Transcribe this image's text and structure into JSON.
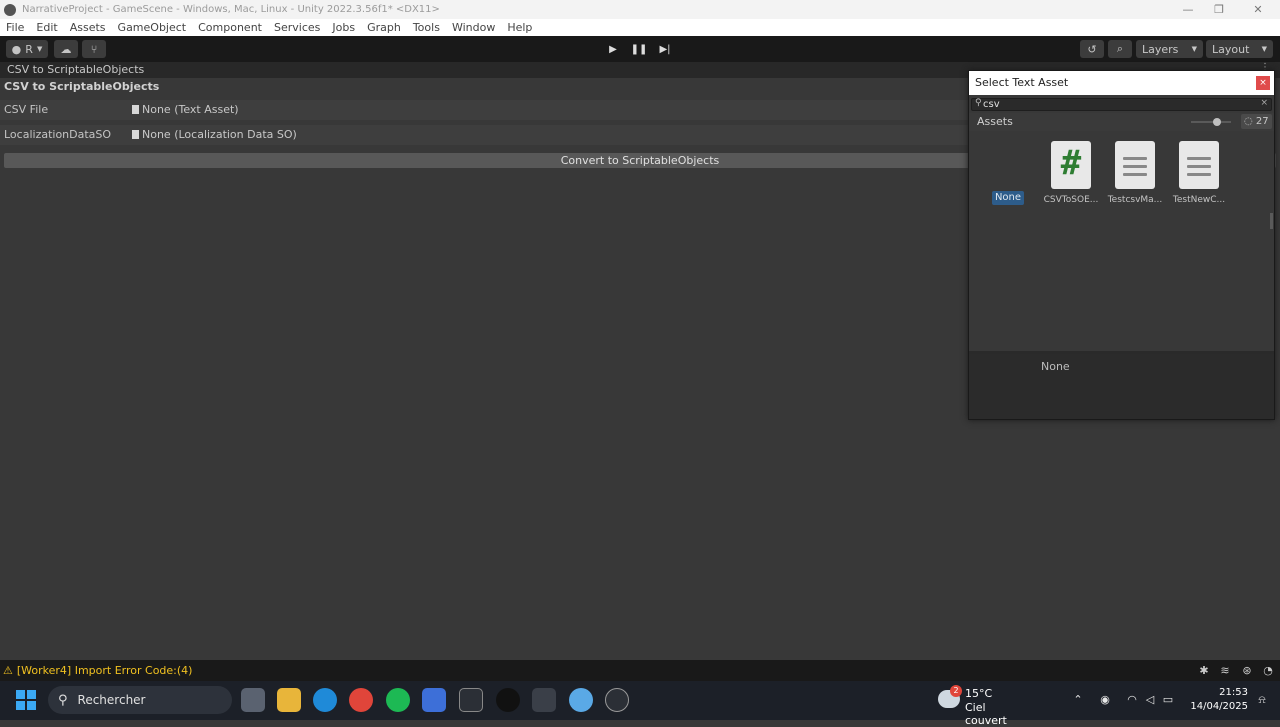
{
  "window": {
    "title": "NarrativeProject - GameScene - Windows, Mac, Linux - Unity 2022.3.56f1* <DX11>",
    "minimize_glyph": "—",
    "restore_glyph": "❐",
    "close_glyph": "✕"
  },
  "menu": [
    "File",
    "Edit",
    "Assets",
    "GameObject",
    "Component",
    "Services",
    "Jobs",
    "Graph",
    "Tools",
    "Window",
    "Help"
  ],
  "toolbar": {
    "account_label": "R",
    "layers_label": "Layers",
    "layout_label": "Layout"
  },
  "editor_window": {
    "tab_label": "CSV to ScriptableObjects",
    "header": "CSV to ScriptableObjects",
    "fields": [
      {
        "label": "CSV File",
        "value": "None (Text Asset)"
      },
      {
        "label": "LocalizationDataSO",
        "value": "None (Localization Data SO)"
      }
    ],
    "convert_button": "Convert to ScriptableObjects"
  },
  "status_bar": {
    "message": "[Worker4] Import Error Code:(4)"
  },
  "select_dialog": {
    "title": "Select Text Asset",
    "close_glyph": "×",
    "search_value": "csv",
    "assets_tab": "Assets",
    "hidden_count": "27",
    "none_label": "None",
    "items": [
      {
        "name": "CSVToSOE...",
        "icon": "csharp-script-icon"
      },
      {
        "name": "TestcsvMa...",
        "icon": "text-document-icon"
      },
      {
        "name": "TestNewC...",
        "icon": "text-document-icon"
      }
    ],
    "preview_label": "None"
  },
  "taskbar": {
    "search_placeholder": "Rechercher",
    "weather_temp": "15°C",
    "weather_desc": "Ciel couvert",
    "weather_badge": "2",
    "time": "21:53",
    "date": "14/04/2025"
  },
  "colors": {
    "accent_blue": "#2d5c8a",
    "warning_yellow": "#f0c020",
    "close_red": "#e04b4b"
  }
}
